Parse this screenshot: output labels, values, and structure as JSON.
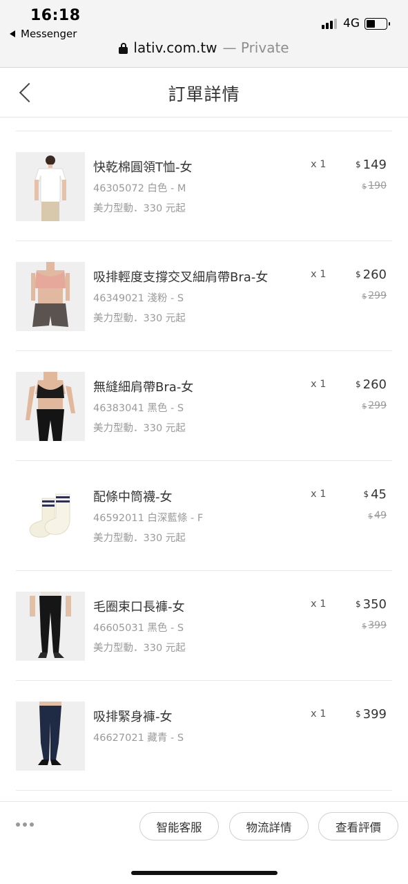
{
  "status": {
    "time": "16:18",
    "back_app": "Messenger",
    "network": "4G",
    "url_domain": "lativ.com.tw",
    "url_mode": "— Private"
  },
  "header": {
    "title": "訂單詳情"
  },
  "items": [
    {
      "name": "快乾棉圓領T恤-女",
      "sku": "46305072 白色 - M",
      "promo": "美力型動．330 元起",
      "qty": "x 1",
      "currency": "$",
      "price": "149",
      "orig_price": "190",
      "thumb": "white-tshirt"
    },
    {
      "name": "吸排輕度支撐交叉細肩帶Bra-女",
      "sku": "46349021 淺粉 - S",
      "promo": "美力型動．330 元起",
      "qty": "x 1",
      "currency": "$",
      "price": "260",
      "orig_price": "299",
      "thumb": "pink-bra"
    },
    {
      "name": "無縫細肩帶Bra-女",
      "sku": "46383041 黑色 - S",
      "promo": "美力型動．330 元起",
      "qty": "x 1",
      "currency": "$",
      "price": "260",
      "orig_price": "299",
      "thumb": "black-bra"
    },
    {
      "name": "配條中筒襪-女",
      "sku": "46592011 白深藍條 - F",
      "promo": "美力型動．330 元起",
      "qty": "x 1",
      "currency": "$",
      "price": "45",
      "orig_price": "49",
      "thumb": "striped-socks"
    },
    {
      "name": "毛圈束口長褲-女",
      "sku": "46605031 黑色 - S",
      "promo": "美力型動．330 元起",
      "qty": "x 1",
      "currency": "$",
      "price": "350",
      "orig_price": "399",
      "thumb": "black-joggers"
    },
    {
      "name": "吸排緊身褲-女",
      "sku": "46627021 藏青 - S",
      "promo": "",
      "qty": "x 1",
      "currency": "$",
      "price": "399",
      "orig_price": "",
      "thumb": "navy-leggings"
    }
  ],
  "bottom_bar": {
    "buttons": [
      "智能客服",
      "物流詳情",
      "查看評價"
    ]
  },
  "colors": {
    "text": "#333333",
    "muted": "#9a9a9a",
    "divider": "#e8e8e8"
  }
}
